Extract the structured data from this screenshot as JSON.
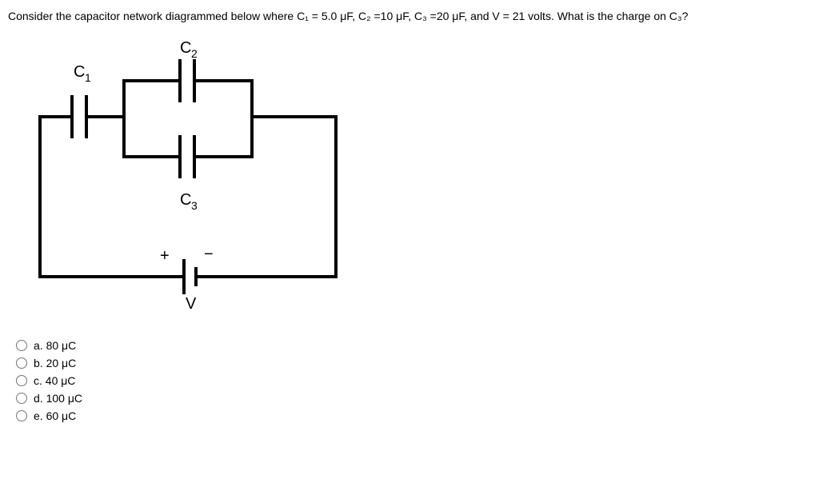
{
  "question": "Consider the capacitor network diagrammed below where C₁ = 5.0 μF, C₂ =10 μF, C₃ =20 μF, and V = 21 volts. What is the charge on C₃?",
  "labels": {
    "c1": "C₁",
    "c2": "C₂",
    "c3": "C₃",
    "v": "V",
    "plus": "+",
    "minus": "−"
  },
  "options": [
    {
      "id": "a",
      "label": "a. 80 μC"
    },
    {
      "id": "b",
      "label": "b. 20 μC"
    },
    {
      "id": "c",
      "label": "c. 40 μC"
    },
    {
      "id": "d",
      "label": "d. 100 μC"
    },
    {
      "id": "e",
      "label": "e. 60 μC"
    }
  ]
}
